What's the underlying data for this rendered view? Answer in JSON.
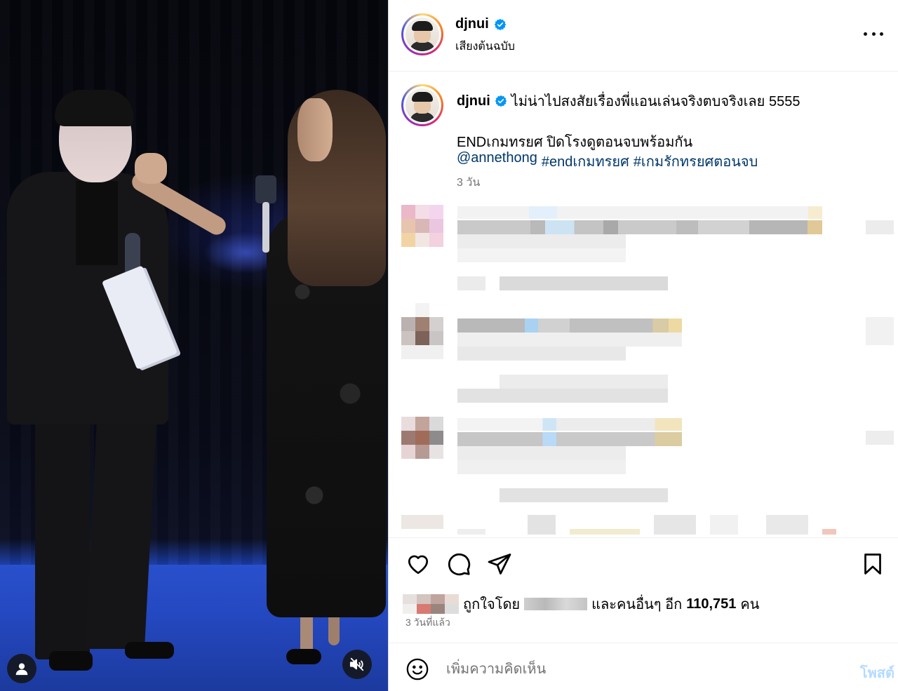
{
  "post": {
    "username": "djnui",
    "verified": true,
    "audio_label": "เสียงต้นฉบับ",
    "caption_line1": "ไม่น่าไปสงสัยเรื่องพี่แอนเล่นจริงตบจริงเลย 5555",
    "caption_line2": "ENDเกมทรยศ ปิดโรงดูตอนจบพร้อมกัน",
    "tags": [
      "@annethong",
      "#endเกมทรยศ",
      "#เกมรักทรยศตอนจบ"
    ],
    "time_ago": "3 วัน"
  },
  "engagement": {
    "liked_by_label": "ถูกใจโดย",
    "and_others_label": "และคนอื่นๆ อีก",
    "others_count": "110,751",
    "people_unit": "คน",
    "date_label": "3 วันที่แล้ว"
  },
  "comment_box": {
    "placeholder": "เพิ่มความคิดเห็น",
    "post_label": "โพสต์"
  },
  "icons": {
    "more": "more-horizontal-icon",
    "like": "heart-icon",
    "comment": "speech-bubble-icon",
    "share": "paper-plane-icon",
    "save": "bookmark-icon",
    "emoji": "smiley-icon",
    "mute": "muted-speaker-icon",
    "tagged": "person-icon",
    "verified": "verified-badge-icon"
  },
  "colors": {
    "verified_blue": "#0095f6",
    "hashtag_blue": "#00376b",
    "muted_text": "#737373",
    "post_button_disabled": "#b3dbff"
  }
}
